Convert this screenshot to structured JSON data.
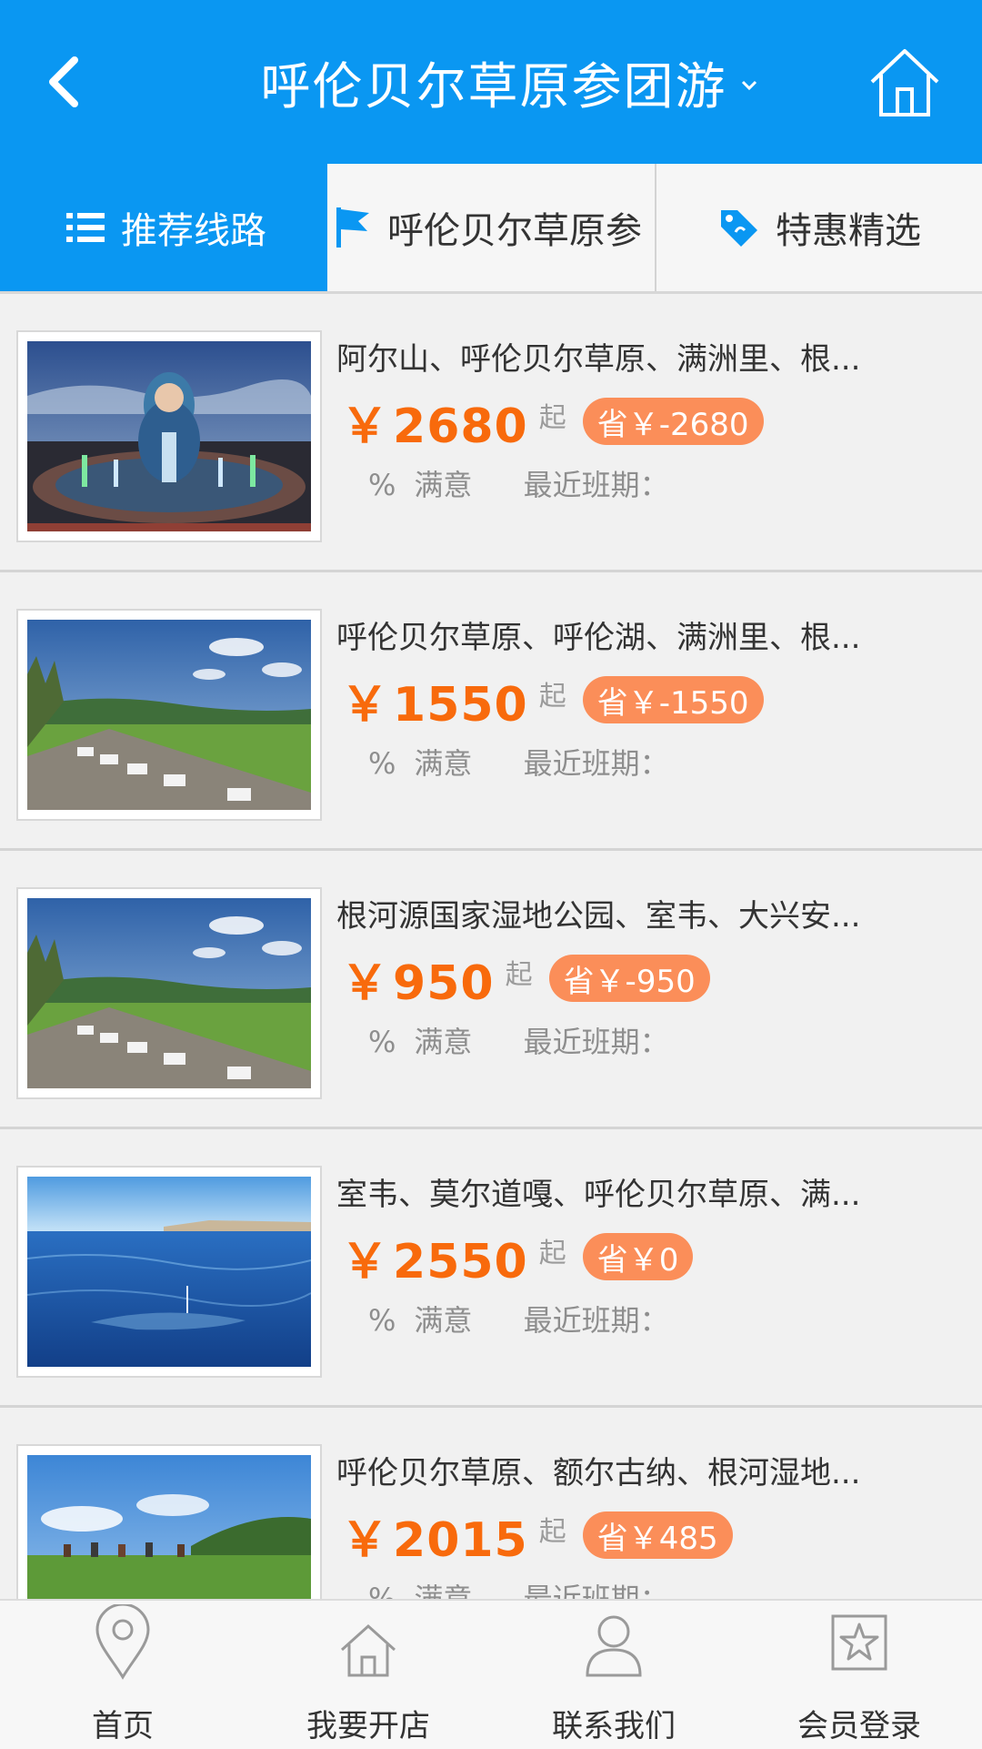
{
  "header": {
    "title": "呼伦贝尔草原参团游",
    "bg_color": "#0a97f2",
    "back_icon": "chevron-left-icon",
    "home_icon": "home-icon"
  },
  "tabs": [
    {
      "label": "推荐线路",
      "icon": "list-icon",
      "active": true
    },
    {
      "label": "呼伦贝尔草原参",
      "icon": "flag-icon",
      "active": false
    },
    {
      "label": "特惠精选",
      "icon": "tag-icon",
      "active": false
    }
  ],
  "accent_color": "#f86a0c",
  "badge_color": "#fb8e59",
  "products": [
    {
      "title": "阿尔山、呼伦贝尔草原、满洲里、根...",
      "currency": "￥",
      "price": "2680",
      "from": "起",
      "save": "省￥-2680",
      "satisfaction": "%",
      "satisfaction_label": "满意",
      "schedule": "最近班期：",
      "image": "fountain-square-photo"
    },
    {
      "title": "呼伦贝尔草原、呼伦湖、满洲里、根...",
      "currency": "￥",
      "price": "1550",
      "from": "起",
      "save": "省￥-1550",
      "satisfaction": "%",
      "satisfaction_label": "满意",
      "schedule": "最近班期：",
      "image": "grassland-campsite-photo"
    },
    {
      "title": "根河源国家湿地公园、室韦、大兴安...",
      "currency": "￥",
      "price": "950",
      "from": "起",
      "save": "省￥-950",
      "satisfaction": "%",
      "satisfaction_label": "满意",
      "schedule": "最近班期：",
      "image": "grassland-campsite-photo"
    },
    {
      "title": "室韦、莫尔道嘎、呼伦贝尔草原、满...",
      "currency": "￥",
      "price": "2550",
      "from": "起",
      "save": "省￥0",
      "satisfaction": "%",
      "satisfaction_label": "满意",
      "schedule": "最近班期：",
      "image": "lake-water-photo"
    },
    {
      "title": "呼伦贝尔草原、额尔古纳、根河湿地...",
      "currency": "￥",
      "price": "2015",
      "from": "起",
      "save": "省￥485",
      "satisfaction": "%",
      "satisfaction_label": "满意",
      "schedule": "最近班期：",
      "image": "horse-riding-photo"
    }
  ],
  "bottom_nav": [
    {
      "label": "首页",
      "icon": "location-pin-icon"
    },
    {
      "label": "我要开店",
      "icon": "home-icon"
    },
    {
      "label": "联系我们",
      "icon": "user-icon"
    },
    {
      "label": "会员登录",
      "icon": "star-icon"
    }
  ]
}
